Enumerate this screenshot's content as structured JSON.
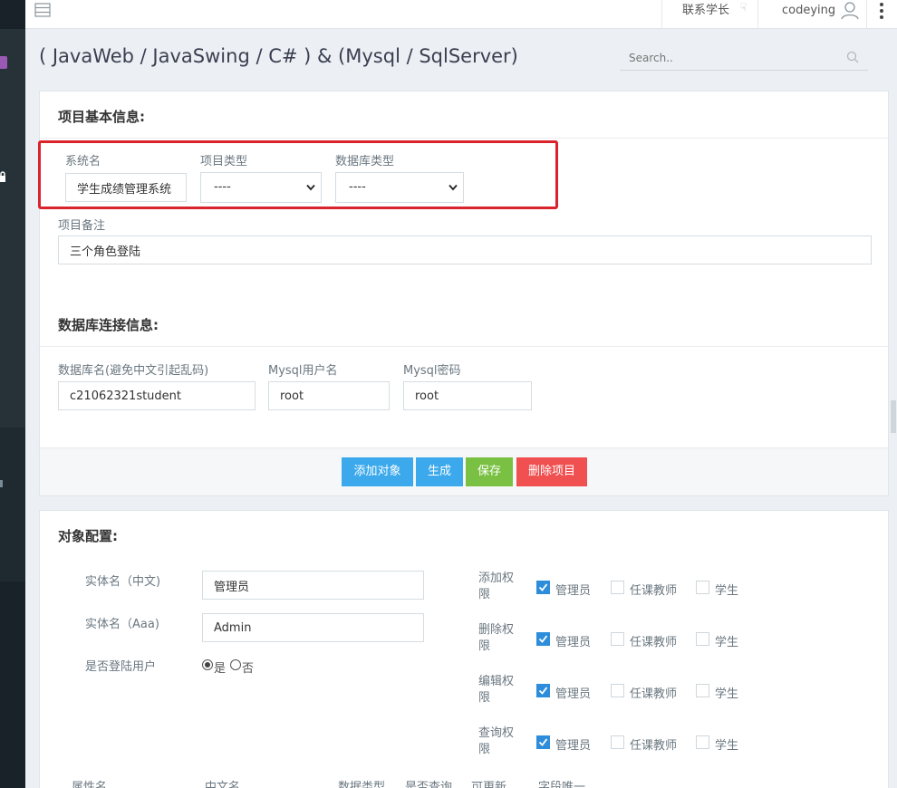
{
  "top_bar": {
    "contact": "联系学长",
    "username": "codeying"
  },
  "page_title": "( JavaWeb / JavaSwing / C# ) & (Mysql / SqlServer)",
  "search": {
    "placeholder": "Search.."
  },
  "project_info": {
    "title": "项目基本信息:",
    "system_name_label": "系统名",
    "system_name_value": "学生成绩管理系统",
    "project_type_label": "项目类型",
    "project_type_value": "----",
    "db_type_label": "数据库类型",
    "db_type_value": "----",
    "remark_label": "项目备注",
    "remark_value": "三个角色登陆"
  },
  "db_info": {
    "title": "数据库连接信息:",
    "db_name_label": "数据库名(避免中文引起乱码)",
    "db_name_value": "c21062321student",
    "user_label": "Mysql用户名",
    "user_value": "root",
    "password_label": "Mysql密码",
    "password_value": "root"
  },
  "buttons": {
    "add_object": "添加对象",
    "generate": "生成",
    "save": "保存",
    "delete": "删除项目"
  },
  "object_config": {
    "title": "对象配置:",
    "entity_cn_label": "实体名（中文)",
    "entity_cn_value": "管理员",
    "entity_en_label": "实体名（Aaa)",
    "entity_en_value": "Admin",
    "login_user_label": "是否登陆用户",
    "yes": "是",
    "no": "否",
    "roles": [
      "管理员",
      "任课教师",
      "学生"
    ],
    "permissions": [
      {
        "line1": "添加权",
        "line2": "限"
      },
      {
        "line1": "删除权",
        "line2": "限"
      },
      {
        "line1": "编辑权",
        "line2": "限"
      },
      {
        "line1": "查询权",
        "line2": "限"
      }
    ],
    "table_headers": [
      "属性名",
      "中文名",
      "数据类型",
      "是否查询",
      "可更新",
      "字段唯一"
    ]
  }
}
